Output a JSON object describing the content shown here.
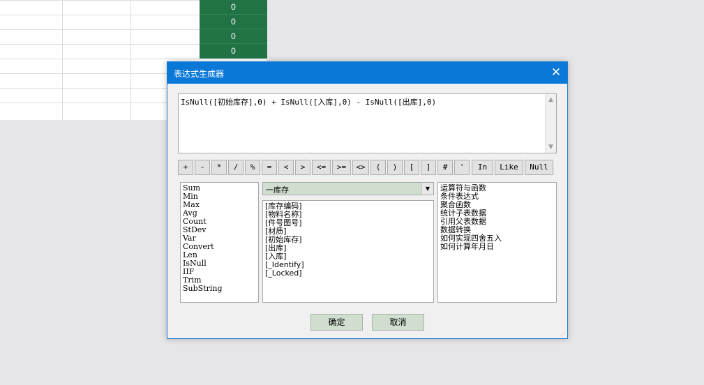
{
  "sheet": {
    "green_cells": [
      "0",
      "0",
      "0",
      "0"
    ]
  },
  "dialog": {
    "title": "表达式生成器",
    "close_glyph": "✕",
    "expression": "IsNull([初始库存],0) + IsNull([入库],0) - IsNull([出库],0)",
    "operators": [
      "+",
      "-",
      "*",
      "/",
      "%",
      "=",
      "<",
      ">",
      "<=",
      ">=",
      "<>",
      "(",
      ")",
      "[",
      "]",
      "#",
      "'",
      "In",
      "Like",
      "Null"
    ],
    "functions": [
      "Sum",
      "Min",
      "Max",
      "Avg",
      "Count",
      "StDev",
      "Var",
      "Convert",
      "Len",
      "IsNull",
      "IIF",
      "Trim",
      "SubString"
    ],
    "table_select": "一库存",
    "fields": [
      "[库存编码]",
      "[物料名称]",
      "[件号图号]",
      "[材质]",
      "[初始库存]",
      "[出库]",
      "[入库]",
      "[_Identify]",
      "[_Locked]"
    ],
    "help_items": [
      "运算符与函数",
      "条件表达式",
      "聚合函数",
      "统计子表数据",
      "引用父表数据",
      "数据转换",
      "如何实现四舍五入",
      "如何计算年月日"
    ],
    "ok_label": "确定",
    "cancel_label": "取消"
  }
}
